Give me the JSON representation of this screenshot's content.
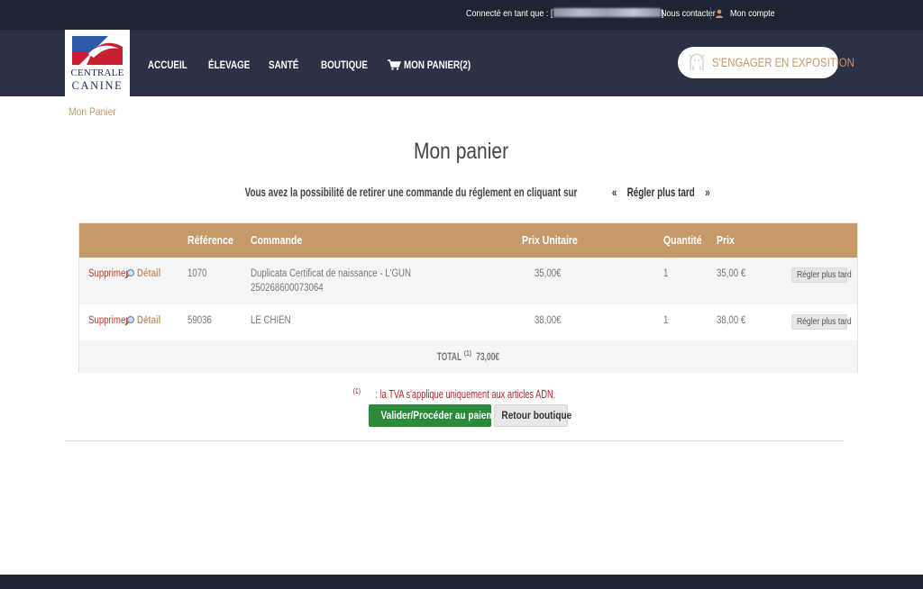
{
  "topbar": {
    "connected_prefix": "Connecté en tant que : [",
    "connected_suffix": "]",
    "contact": "Nous contacter",
    "account": "Mon compte"
  },
  "logo": {
    "line1": "Centrale",
    "line2": "Canine"
  },
  "nav": {
    "home": "ACCUEIL",
    "breeding": "ÉLEVAGE",
    "health": "SANTÉ",
    "shop": "BOUTIQUE",
    "cart": "MON PANIER(2)"
  },
  "engage_button": "S'ENGAGER EN EXPOSITION",
  "breadcrumb": "Mon Panier",
  "page_title": "Mon panier",
  "intro": {
    "text": "Vous avez la possibilité de retirer une commande du réglement en cliquant sur",
    "quote_open": "«",
    "highlight": "Régler plus tard",
    "quote_close": "»"
  },
  "table": {
    "headers": {
      "reference": "Référence",
      "order": "Commande",
      "unit_price": "Prix Unitaire",
      "quantity": "Quantité",
      "price": "Prix"
    },
    "rows": [
      {
        "delete": "Supprimer",
        "detail": "Détail",
        "reference": "1070",
        "order_line1": "Duplicata Certificat de naissance - L'GUN",
        "order_line2": "250268600073064",
        "unit_price": "35,00€",
        "quantity": "1",
        "price": "35,00 €",
        "later": "Régler plus tard"
      },
      {
        "delete": "Supprimer",
        "detail": "Détail",
        "reference": "59036",
        "order_line1": "LE CHIEN",
        "order_line2": "",
        "unit_price": "38,00€",
        "quantity": "1",
        "price": "38,00 €",
        "later": "Régler plus tard"
      }
    ],
    "total_label": "TOTAL",
    "total_note": "(1)",
    "total_value": "73,00€"
  },
  "tva_note": {
    "mark": "(1)",
    "text": ": la TVA s'applique uniquement aux articles ADN."
  },
  "buttons": {
    "pay": "Valider/Procéder au paiement",
    "back": "Retour boutique"
  },
  "colors": {
    "topbar": "#1f2433",
    "header": "#2d3146",
    "accent": "#c5996a",
    "pay_button": "#2a8a3a",
    "warning": "#b3282d"
  }
}
